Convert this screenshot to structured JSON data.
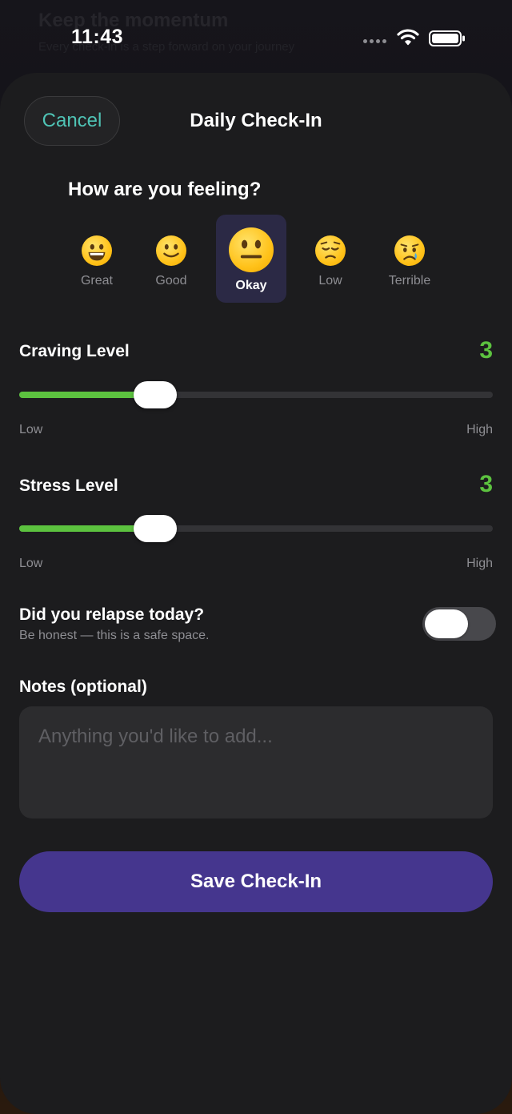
{
  "background": {
    "title": "Keep the momentum",
    "subtitle": "Every check-in is a step forward on your journey"
  },
  "status_bar": {
    "time": "11:43"
  },
  "sheet": {
    "cancel_label": "Cancel",
    "title": "Daily Check-In"
  },
  "mood": {
    "question": "How are you feeling?",
    "selected": "Okay",
    "options": [
      {
        "label": "Great",
        "icon": "grinning-face-icon"
      },
      {
        "label": "Good",
        "icon": "slightly-smiling-face-icon"
      },
      {
        "label": "Okay",
        "icon": "neutral-face-icon"
      },
      {
        "label": "Low",
        "icon": "pensive-face-icon"
      },
      {
        "label": "Terrible",
        "icon": "crying-face-icon"
      }
    ]
  },
  "craving": {
    "title": "Craving Level",
    "value": "3",
    "level": 3,
    "min": 1,
    "max": 10,
    "low_label": "Low",
    "high_label": "High"
  },
  "stress": {
    "title": "Stress Level",
    "value": "3",
    "level": 3,
    "min": 1,
    "max": 10,
    "low_label": "Low",
    "high_label": "High"
  },
  "relapse": {
    "title": "Did you relapse today?",
    "subtitle": "Be honest — this is a safe space.",
    "toggle_on": false
  },
  "notes": {
    "label": "Notes (optional)",
    "placeholder": "Anything you'd like to add...",
    "value": ""
  },
  "save_label": "Save Check-In",
  "colors": {
    "accent_green": "#5cc23f",
    "accent_teal": "#4fc3b5",
    "primary_button": "#45368e",
    "selected_mood_bg": "#2b2945"
  }
}
